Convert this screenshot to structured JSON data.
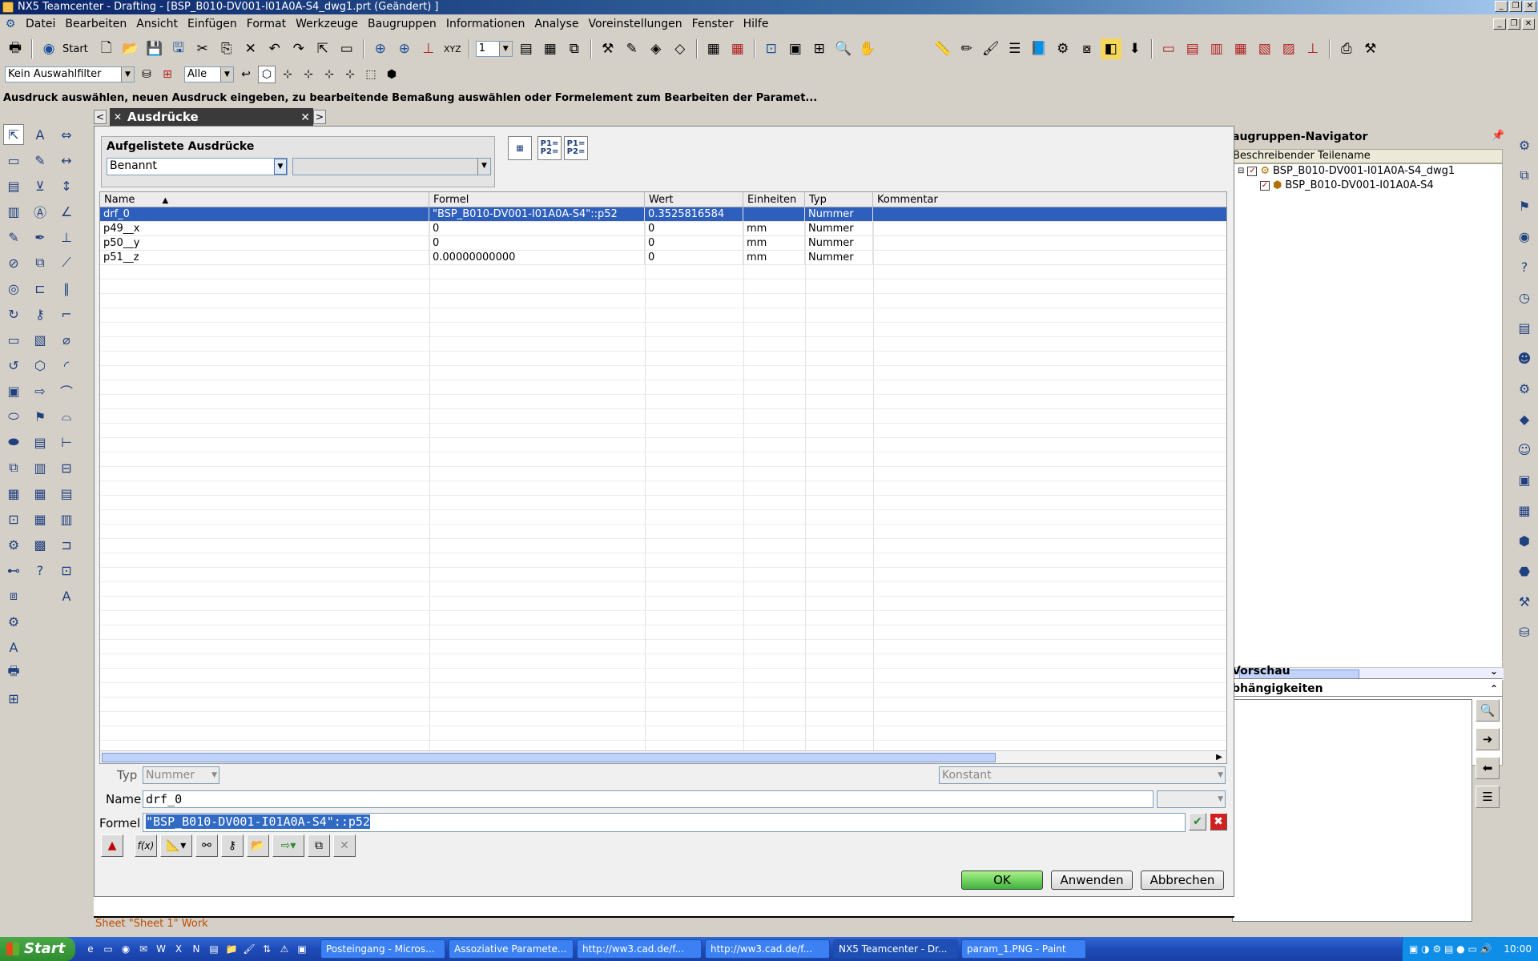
{
  "window": {
    "title": "NX5 Teamcenter - Drafting - [BSP_B010-DV001-I01A0A-S4_dwg1.prt (Geändert) ]"
  },
  "menu": [
    "Datei",
    "Bearbeiten",
    "Ansicht",
    "Einfügen",
    "Format",
    "Werkzeuge",
    "Baugruppen",
    "Informationen",
    "Analyse",
    "Voreinstellungen",
    "Fenster",
    "Hilfe"
  ],
  "toolbar": {
    "start_label": "Start",
    "layer_value": "1",
    "selection_filter": "Kein Auswahlfilter",
    "scope": "Alle",
    "xyz_label": "XYZ"
  },
  "status_prompt": "Ausdruck auswählen, neuen Ausdruck eingeben, zu bearbeitende Bemaßung auswählen oder Formelement zum Bearbeiten der Paramet...",
  "dialog": {
    "tab_title": "Ausdrücke",
    "listed_group_title": "Aufgelistete Ausdrücke",
    "listed_filter": "Benannt",
    "icon_labels": [
      "P1=\nP2=",
      "P1=\nP2="
    ],
    "columns": [
      "Name",
      "Formel",
      "Wert",
      "Einheiten",
      "Typ",
      "Kommentar"
    ],
    "rows": [
      {
        "name": "drf_0",
        "formula": "\"BSP_B010-DV001-I01A0A-S4\"::p52",
        "value": "0.3525816584",
        "unit": "",
        "type": "Nummer",
        "comment": ""
      },
      {
        "name": "p49__x",
        "formula": "0",
        "value": "0",
        "unit": "mm",
        "type": "Nummer",
        "comment": ""
      },
      {
        "name": "p50__y",
        "formula": "0",
        "value": "0",
        "unit": "mm",
        "type": "Nummer",
        "comment": ""
      },
      {
        "name": "p51__z",
        "formula": "0.00000000000",
        "value": "0",
        "unit": "mm",
        "type": "Nummer",
        "comment": ""
      }
    ],
    "type_label": "Typ",
    "type_value": "Nummer",
    "constant_value": "Konstant",
    "name_label": "Name",
    "name_value": "drf_0",
    "formula_label": "Formel",
    "formula_value": "\"BSP_B010-DV001-I01A0A-S4\"::p52",
    "fx_label": "f(x)",
    "ok_label": "OK",
    "apply_label": "Anwenden",
    "cancel_label": "Abbrechen"
  },
  "navigator": {
    "title": "augruppen-Navigator",
    "column_header": "Beschreibender Teilename",
    "items": [
      "BSP_B010-DV001-I01A0A-S4_dwg1",
      "BSP_B010-DV001-I01A0A-S4"
    ],
    "preview_label": "Vorschau",
    "dependencies_label": "bhängigkeiten"
  },
  "sheet_label": "Sheet \"Sheet 1\" Work",
  "taskbar": {
    "start": "Start",
    "tasks": [
      {
        "label": "Posteingang - Micros...",
        "active": false
      },
      {
        "label": "Assoziative Paramete...",
        "active": false
      },
      {
        "label": "http://ww3.cad.de/f...",
        "active": false
      },
      {
        "label": "http://ww3.cad.de/f...",
        "active": false
      },
      {
        "label": "NX5 Teamcenter - Dr...",
        "active": true
      },
      {
        "label": "param_1.PNG - Paint",
        "active": false
      }
    ],
    "clock": "10:00"
  }
}
